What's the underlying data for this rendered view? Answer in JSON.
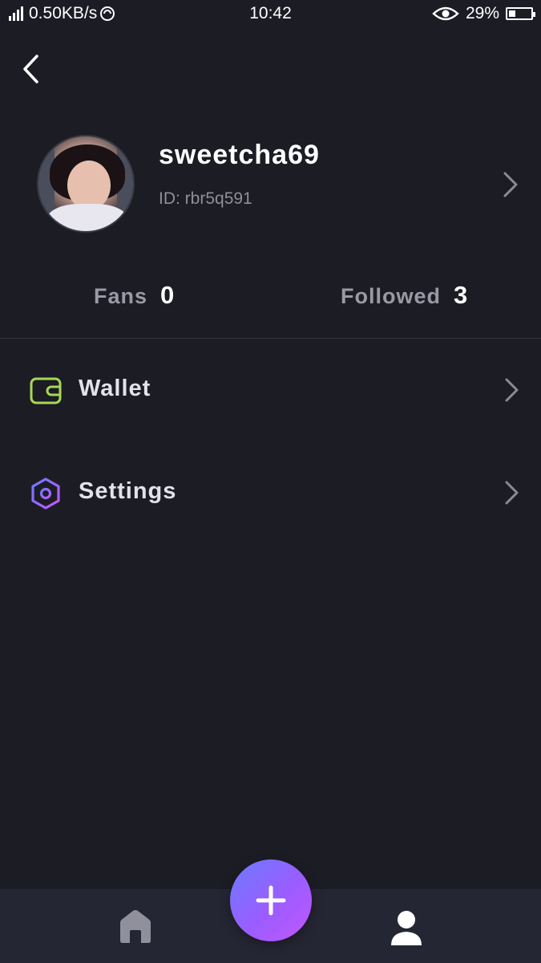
{
  "status_bar": {
    "network_speed": "0.50KB/s",
    "time": "10:42",
    "battery": "29%",
    "battery_level": 0.29
  },
  "profile": {
    "username": "sweetcha69",
    "id_text": "ID: rbr5q591"
  },
  "stats": {
    "fans_label": "Fans",
    "fans_value": "0",
    "followed_label": "Followed",
    "followed_value": "3"
  },
  "menu": {
    "wallet_label": "Wallet",
    "settings_label": "Settings"
  },
  "colors": {
    "background": "#1c1c25",
    "wallet_icon": "#a6d854",
    "settings_icon_start": "#6a7bff",
    "settings_icon_end": "#c257ff",
    "fab_gradient_start": "#6a7bff",
    "fab_gradient_end": "#c257ff"
  },
  "icons": {
    "back": "chevron-left-icon",
    "profile_chevron": "chevron-right-icon",
    "wallet": "wallet-icon",
    "settings": "hexagon-settings-icon",
    "home": "home-icon",
    "add": "plus-icon",
    "profile": "user-icon"
  }
}
